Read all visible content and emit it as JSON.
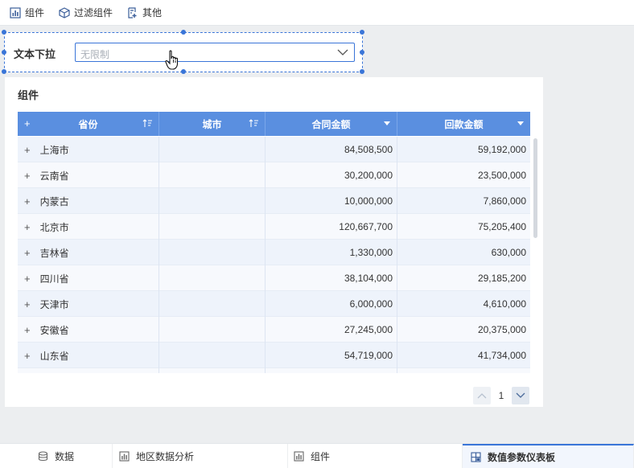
{
  "toolbar": {
    "items": [
      {
        "label": "组件",
        "icon": "chart-icon"
      },
      {
        "label": "过滤组件",
        "icon": "filter-cube-icon"
      },
      {
        "label": "其他",
        "icon": "other-icon"
      }
    ]
  },
  "filter": {
    "label": "文本下拉",
    "placeholder": "无限制"
  },
  "card": {
    "title": "组件",
    "table": {
      "columns": [
        "省份",
        "城市",
        "合同金额",
        "回款金额"
      ],
      "rows": [
        {
          "province": "上海市",
          "contract": "84,508,500",
          "payment": "59,192,000"
        },
        {
          "province": "云南省",
          "contract": "30,200,000",
          "payment": "23,500,000"
        },
        {
          "province": "内蒙古",
          "contract": "10,000,000",
          "payment": "7,860,000"
        },
        {
          "province": "北京市",
          "contract": "120,667,700",
          "payment": "75,205,400"
        },
        {
          "province": "吉林省",
          "contract": "1,330,000",
          "payment": "630,000"
        },
        {
          "province": "四川省",
          "contract": "38,104,000",
          "payment": "29,185,200"
        },
        {
          "province": "天津市",
          "contract": "6,000,000",
          "payment": "4,610,000"
        },
        {
          "province": "安徽省",
          "contract": "27,245,000",
          "payment": "20,375,000"
        },
        {
          "province": "山东省",
          "contract": "54,719,000",
          "payment": "41,734,000"
        },
        {
          "province": "",
          "contract": "",
          "payment": ""
        }
      ]
    },
    "pager": {
      "page": "1"
    }
  },
  "bottom_tabs": [
    {
      "label": "数据",
      "icon": "database-icon",
      "active": false
    },
    {
      "label": "地区数据分析",
      "icon": "bar-chart-icon",
      "active": false
    },
    {
      "label": "组件",
      "icon": "bar-chart-icon",
      "active": false
    },
    {
      "label": "数值参数仪表板",
      "icon": "dashboard-icon",
      "active": true
    }
  ],
  "colors": {
    "accent": "#3a75d8",
    "header": "#5a8fe0"
  }
}
